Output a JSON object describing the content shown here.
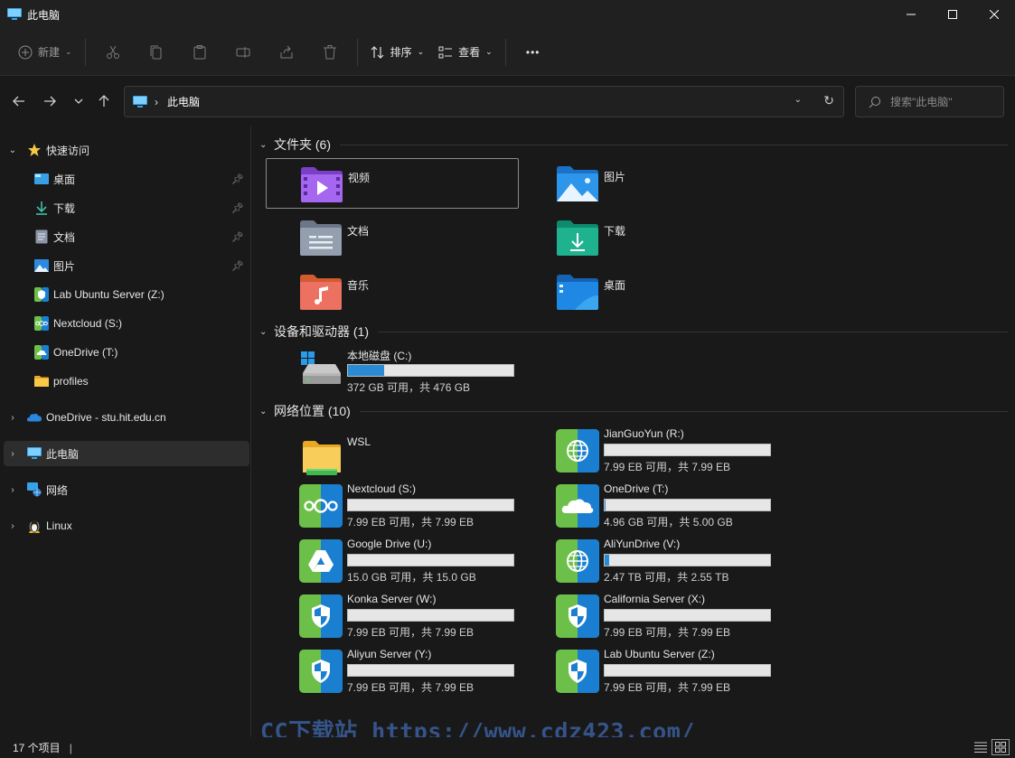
{
  "window": {
    "title": "此电脑",
    "controls": [
      "minimize-icon",
      "maximize-icon",
      "close-icon"
    ]
  },
  "toolbar": {
    "new_label": "新建",
    "sort_label": "排序",
    "view_label": "查看",
    "more_label": "•••"
  },
  "address": {
    "crumb": "此电脑",
    "search_placeholder": "搜索\"此电脑\""
  },
  "sidebar": {
    "quick_access": "快速访问",
    "quick_items": [
      {
        "label": "桌面",
        "icon": "desktop-icon",
        "pinned": true
      },
      {
        "label": "下载",
        "icon": "download-icon",
        "pinned": true
      },
      {
        "label": "文档",
        "icon": "document-icon",
        "pinned": true
      },
      {
        "label": "图片",
        "icon": "pictures-icon",
        "pinned": true
      },
      {
        "label": "Lab Ubuntu Server (Z:)",
        "icon": "network-drive-icon"
      },
      {
        "label": "Nextcloud (S:)",
        "icon": "nextcloud-icon"
      },
      {
        "label": "OneDrive (T:)",
        "icon": "onedrive-icon"
      },
      {
        "label": "profiles",
        "icon": "folder-icon"
      }
    ],
    "onedrive": "OneDrive - stu.hit.edu.cn",
    "this_pc": "此电脑",
    "network": "网络",
    "linux": "Linux"
  },
  "groups": {
    "folders": "文件夹 (6)",
    "devices": "设备和驱动器 (1)",
    "network": "网络位置 (10)"
  },
  "folders": [
    {
      "name": "视频",
      "icon": "videos-folder-icon"
    },
    {
      "name": "图片",
      "icon": "pictures-folder-icon"
    },
    {
      "name": "文档",
      "icon": "documents-folder-icon"
    },
    {
      "name": "下载",
      "icon": "downloads-folder-icon"
    },
    {
      "name": "音乐",
      "icon": "music-folder-icon"
    },
    {
      "name": "桌面",
      "icon": "desktop-folder-icon"
    }
  ],
  "devices": [
    {
      "name": "本地磁盘 (C:)",
      "size": "372 GB 可用，共 476 GB",
      "used_fraction": 0.22
    }
  ],
  "network_locations": [
    {
      "name": "WSL",
      "icon": "wsl-folder-icon"
    },
    {
      "name": "JianGuoYun (R:)",
      "size": "7.99 EB 可用，共 7.99 EB",
      "used_fraction": 0.0,
      "icon": "globe-drive-icon"
    },
    {
      "name": "Nextcloud (S:)",
      "size": "7.99 EB 可用，共 7.99 EB",
      "used_fraction": 0.0,
      "icon": "nextcloud-drive-icon"
    },
    {
      "name": "OneDrive (T:)",
      "size": "4.96 GB 可用，共 5.00 GB",
      "used_fraction": 0.008,
      "icon": "onedrive-drive-icon"
    },
    {
      "name": "Google Drive (U:)",
      "size": "15.0 GB 可用，共 15.0 GB",
      "used_fraction": 0.0,
      "icon": "google-drive-icon"
    },
    {
      "name": "AliYunDrive (V:)",
      "size": "2.47 TB 可用，共 2.55 TB",
      "used_fraction": 0.03,
      "icon": "globe-drive-icon"
    },
    {
      "name": "Konka Server (W:)",
      "size": "7.99 EB 可用，共 7.99 EB",
      "used_fraction": 0.0,
      "icon": "shield-drive-icon"
    },
    {
      "name": "California Server (X:)",
      "size": "7.99 EB 可用，共 7.99 EB",
      "used_fraction": 0.0,
      "icon": "shield-drive-icon"
    },
    {
      "name": "Aliyun Server (Y:)",
      "size": "7.99 EB 可用，共 7.99 EB",
      "used_fraction": 0.0,
      "icon": "shield-drive-icon"
    },
    {
      "name": "Lab Ubuntu Server (Z:)",
      "size": "7.99 EB 可用，共 7.99 EB",
      "used_fraction": 0.0,
      "icon": "shield-drive-icon"
    }
  ],
  "status": {
    "count": "17 个项目",
    "sep": "|"
  },
  "watermark": "CC下载站 https://www.cdz423.com/",
  "colors": {
    "accent": "#2a8ad4",
    "drive_tile_green": "#6cc04a",
    "drive_tile_blue": "#1b7fd1"
  }
}
